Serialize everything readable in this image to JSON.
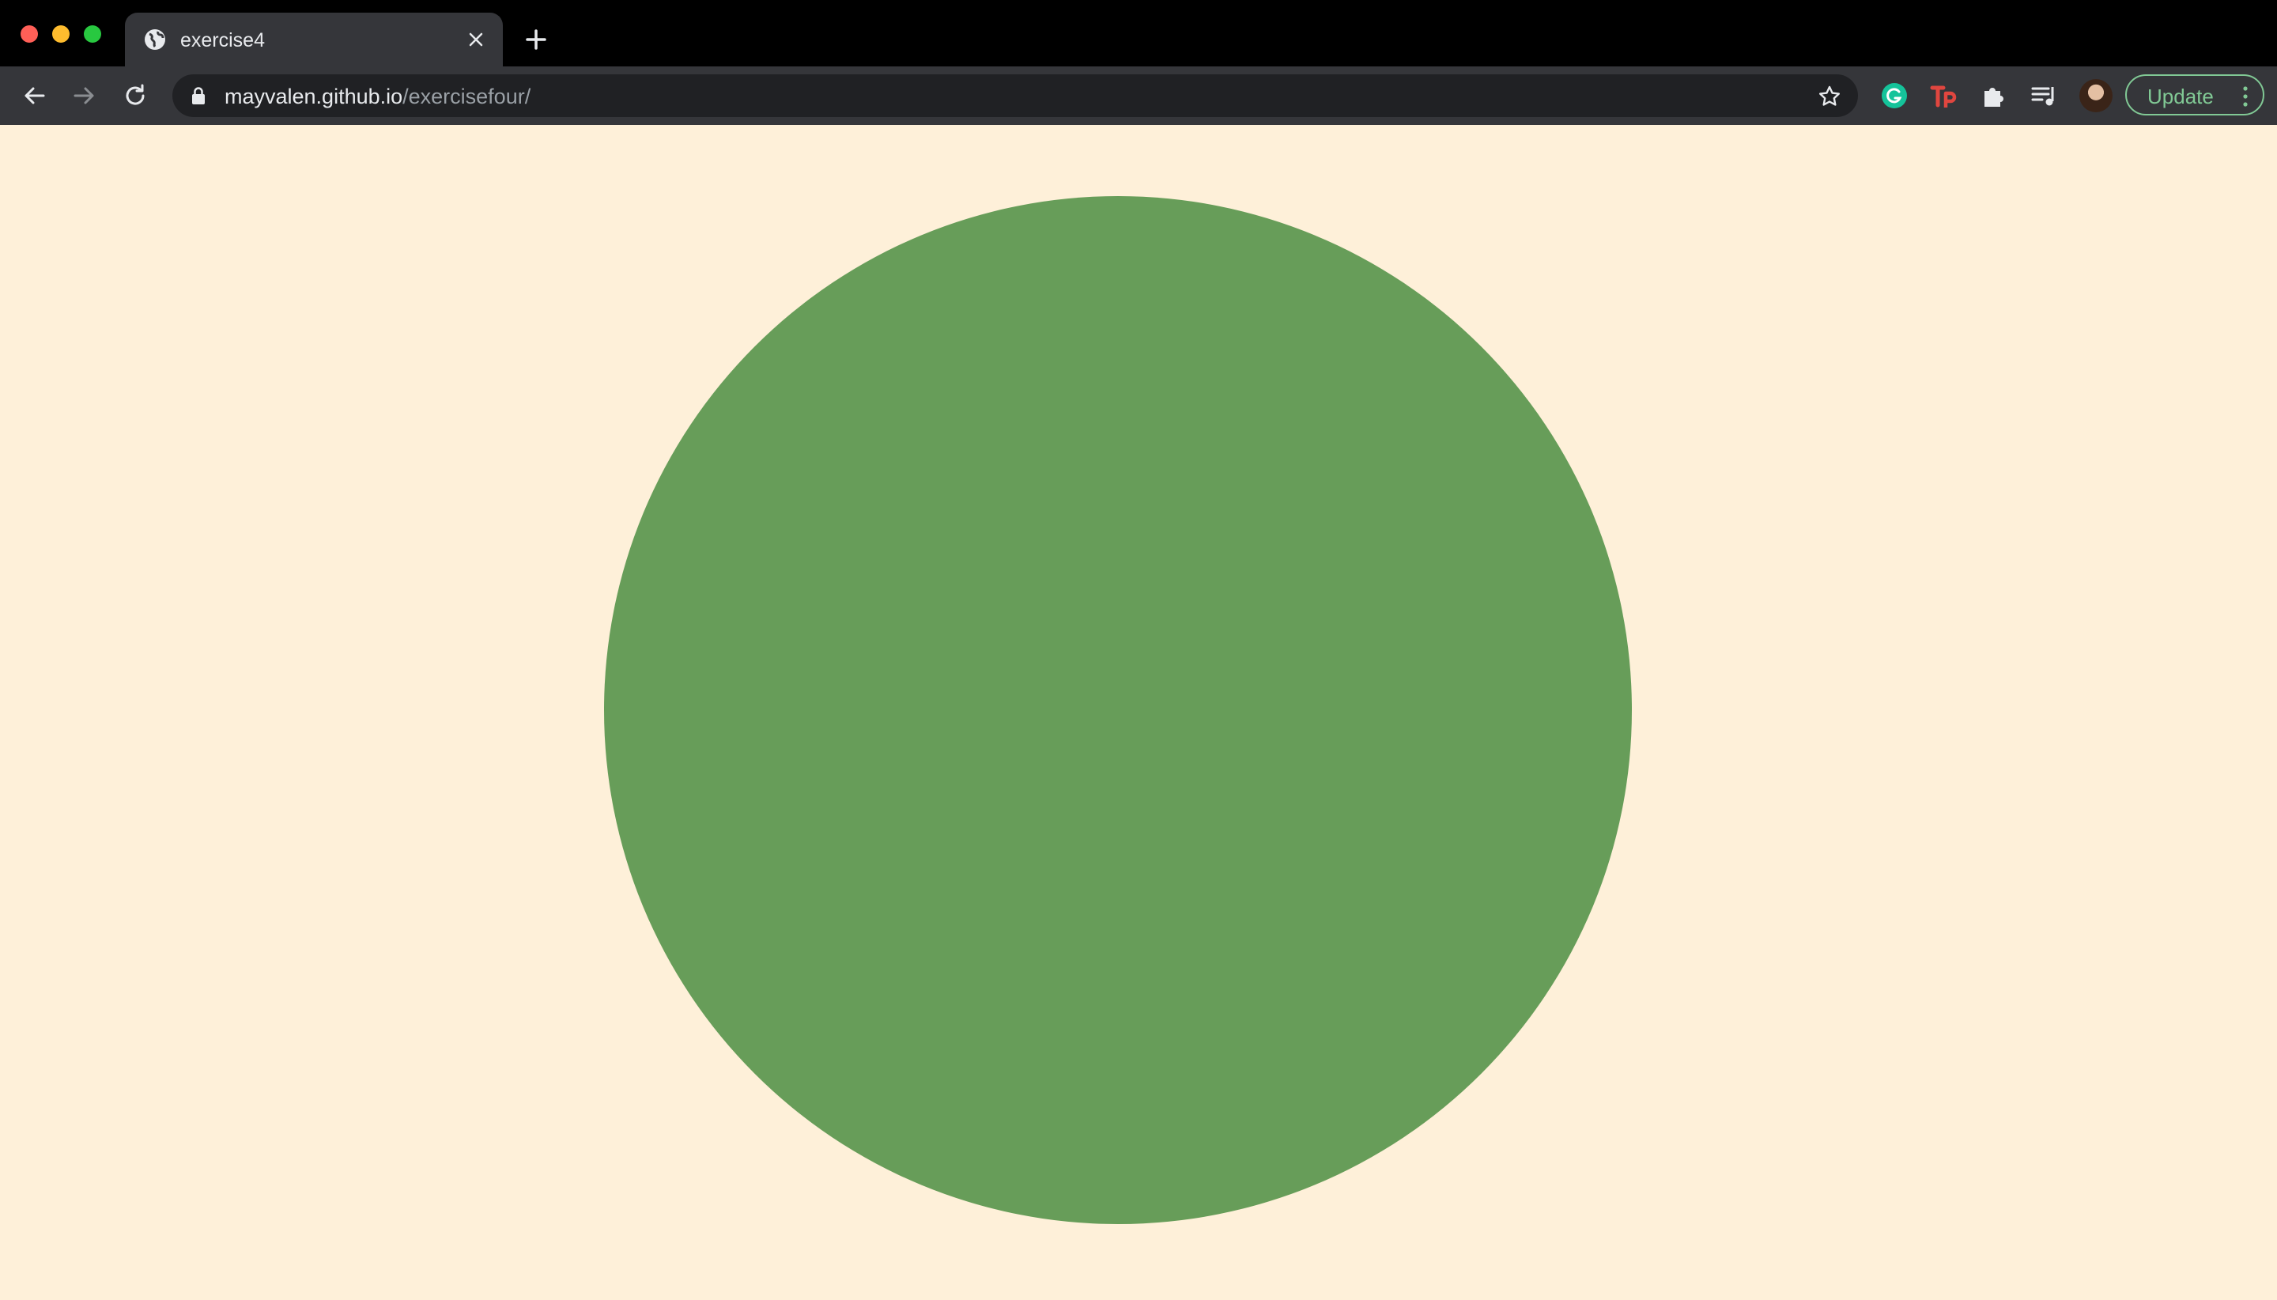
{
  "tab": {
    "title": "exercise4",
    "favicon": "globe-icon"
  },
  "toolbar": {
    "url_host": "mayvalen.github.io",
    "url_path": "/exercisefour/",
    "update_label": "Update"
  },
  "colors": {
    "page_background": "#fef0d9",
    "circle_fill": "#679d59",
    "accent": "#81c995"
  }
}
